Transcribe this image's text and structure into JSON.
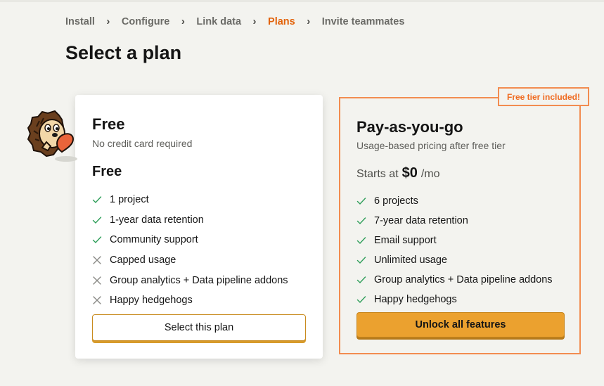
{
  "breadcrumb": {
    "items": [
      "Install",
      "Configure",
      "Link data",
      "Plans",
      "Invite teammates"
    ],
    "active": "Plans"
  },
  "page_title": "Select a plan",
  "plans": {
    "free": {
      "name": "Free",
      "subtitle": "No credit card required",
      "price": "Free",
      "features": [
        {
          "label": "1 project",
          "included": true
        },
        {
          "label": "1-year data retention",
          "included": true
        },
        {
          "label": "Community support",
          "included": true
        },
        {
          "label": "Capped usage",
          "included": false
        },
        {
          "label": "Group analytics + Data pipeline addons",
          "included": false
        },
        {
          "label": "Happy hedgehogs",
          "included": false
        }
      ],
      "button": "Select this plan"
    },
    "paid": {
      "badge": "Free tier included!",
      "name": "Pay-as-you-go",
      "subtitle": "Usage-based pricing after free tier",
      "price_prefix": "Starts at",
      "price_amount": "$0",
      "price_suffix": "/mo",
      "features": [
        {
          "label": "6 projects",
          "included": true
        },
        {
          "label": "7-year data retention",
          "included": true
        },
        {
          "label": "Email support",
          "included": true
        },
        {
          "label": "Unlimited usage",
          "included": true
        },
        {
          "label": "Group analytics + Data pipeline addons",
          "included": true
        },
        {
          "label": "Happy hedgehogs",
          "included": true
        }
      ],
      "button": "Unlock all features"
    }
  },
  "colors": {
    "accent": "#e2620a",
    "highlight_border": "#f28c50",
    "primary_button": "#eba12f",
    "check": "#2f9e5a",
    "cross": "#8a8a86"
  },
  "icons": {
    "included": "checkmark-icon",
    "excluded": "cross-icon",
    "mascot": "hedgehog-mascot"
  }
}
